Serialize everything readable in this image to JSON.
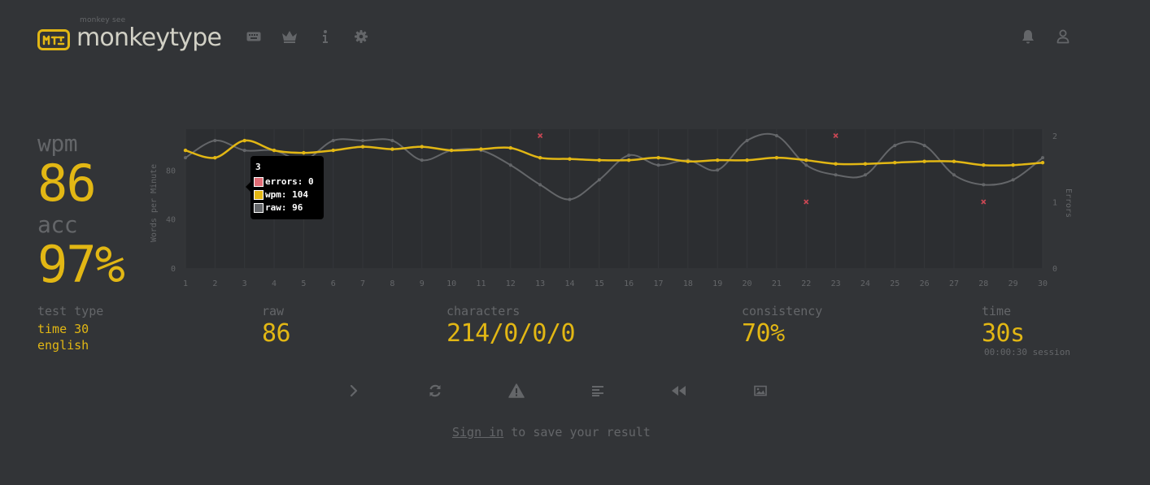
{
  "header": {
    "logo_sub": "monkey see",
    "logo_title": "monkeytype",
    "nav_icons": [
      "keyboard-icon",
      "crown-icon",
      "info-icon",
      "gear-icon"
    ],
    "right_icons": [
      "bell-icon",
      "user-icon"
    ]
  },
  "stats": {
    "wpm_label": "wpm",
    "wpm_value": "86",
    "acc_label": "acc",
    "acc_value": "97%"
  },
  "details": {
    "test_type_label": "test type",
    "test_type_line1": "time 30",
    "test_type_line2": "english",
    "raw_label": "raw",
    "raw_value": "86",
    "characters_label": "characters",
    "characters_value": "214/0/0/0",
    "consistency_label": "consistency",
    "consistency_value": "70%",
    "time_label": "time",
    "time_value": "30s",
    "session_text": "00:00:30 session"
  },
  "tooltip": {
    "title": "3",
    "errors_text": "errors: 0",
    "wpm_text": "wpm: 104",
    "raw_text": "raw: 96"
  },
  "buttons": [
    "next-test-button",
    "restart-button",
    "report-button",
    "word-history-button",
    "replay-button",
    "screenshot-button"
  ],
  "signin": {
    "link": "Sign in",
    "rest": " to save your result"
  },
  "colors": {
    "background": "#323437",
    "main": "#e2b714",
    "sub": "#646669",
    "text": "#d1d0c5",
    "error": "#ca4754"
  },
  "chart_data": {
    "type": "line",
    "x": [
      1,
      2,
      3,
      4,
      5,
      6,
      7,
      8,
      9,
      10,
      11,
      12,
      13,
      14,
      15,
      16,
      17,
      18,
      19,
      20,
      21,
      22,
      23,
      24,
      25,
      26,
      27,
      28,
      29,
      30
    ],
    "series": [
      {
        "name": "wpm",
        "color": "#e2b714",
        "values": [
          96,
          90,
          104,
          96,
          94,
          96,
          99,
          97,
          99,
          96,
          97,
          98,
          90,
          89,
          88,
          88,
          90,
          87,
          88,
          88,
          90,
          88,
          85,
          85,
          86,
          87,
          87,
          84,
          84,
          86
        ]
      },
      {
        "name": "raw",
        "color": "#646669",
        "values": [
          90,
          104,
          96,
          96,
          88,
          104,
          104,
          104,
          88,
          96,
          96,
          84,
          68,
          56,
          72,
          92,
          84,
          88,
          80,
          104,
          108,
          84,
          76,
          76,
          100,
          100,
          76,
          68,
          72,
          90
        ]
      },
      {
        "name": "errors",
        "color": "#ca4754",
        "axis": "right",
        "type": "scatter",
        "points": [
          [
            13,
            2
          ],
          [
            22,
            1
          ],
          [
            23,
            2
          ],
          [
            28,
            1
          ]
        ]
      }
    ],
    "ylabel": "Words per Minute",
    "y2label": "Errors",
    "ylim": [
      0,
      108
    ],
    "y_ticks": [
      0,
      40,
      80
    ],
    "y2lim": [
      0,
      2
    ],
    "y2_ticks": [
      0,
      1,
      2
    ],
    "xlim": [
      1,
      30
    ]
  }
}
